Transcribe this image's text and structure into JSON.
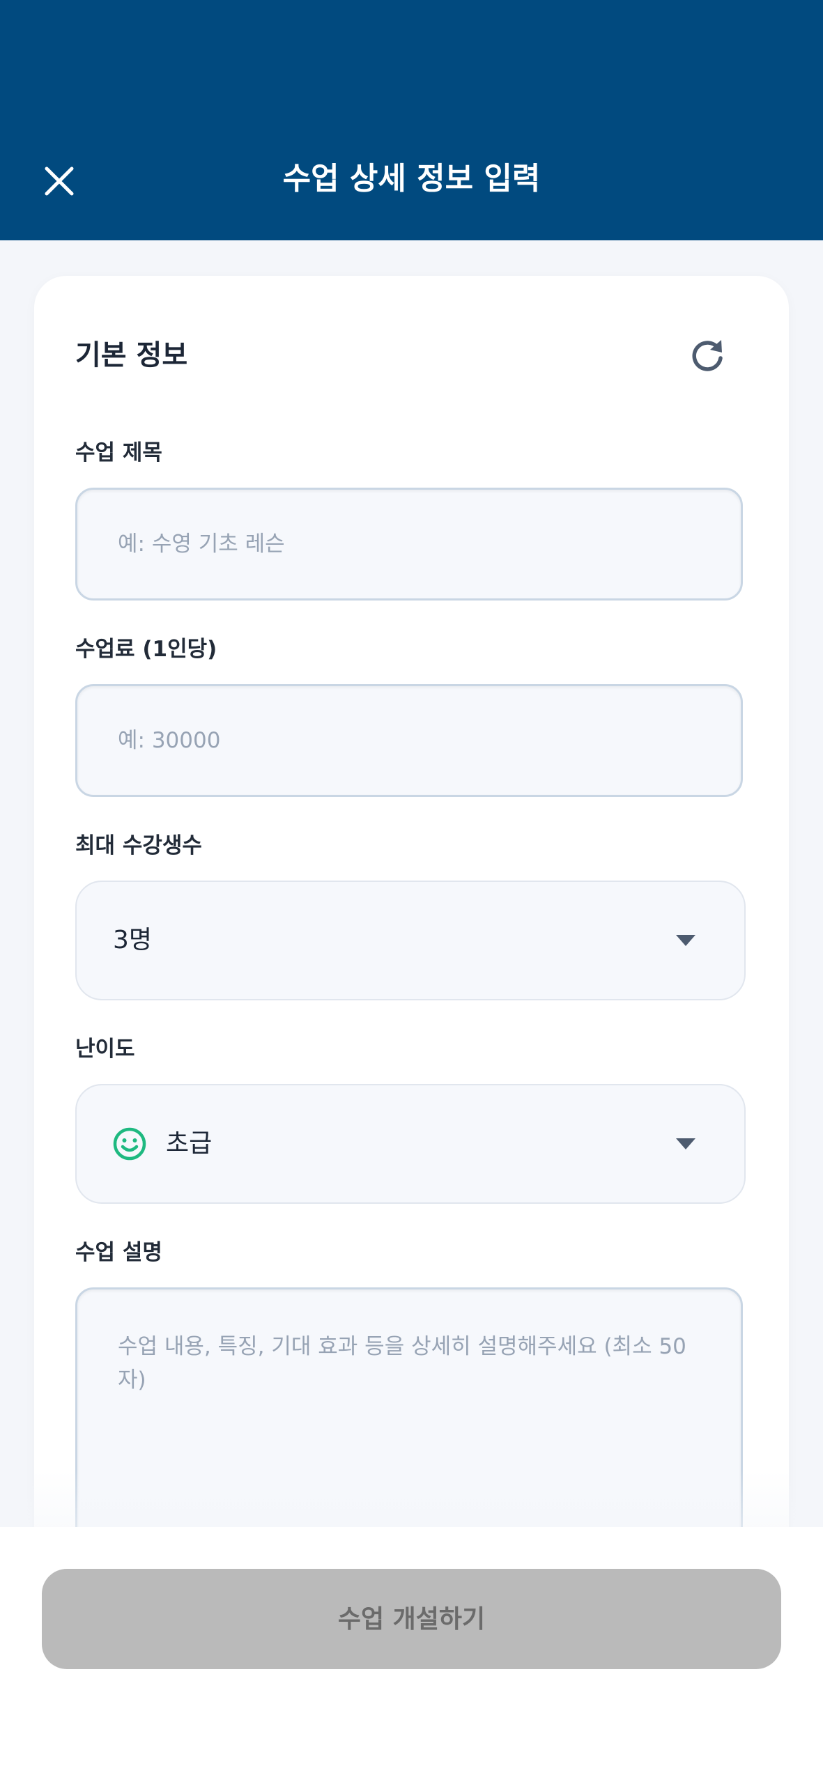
{
  "header": {
    "title": "수업 상세 정보 입력"
  },
  "section": {
    "title": "기본 정보"
  },
  "fields": {
    "title": {
      "label": "수업 제목",
      "placeholder": "예: 수영 기초 레슨"
    },
    "fee": {
      "label": "수업료 (1인당)",
      "placeholder": "예: 30000"
    },
    "max_students": {
      "label": "최대 수강생수",
      "value": "3명"
    },
    "difficulty": {
      "label": "난이도",
      "value": "초급",
      "icon": "smile-icon"
    },
    "description": {
      "label": "수업 설명",
      "placeholder": "수업 내용, 특징, 기대 효과 등을 상세히 설명해주세요 (최소 50자)"
    }
  },
  "footer": {
    "submit_label": "수업 개설하기"
  },
  "colors": {
    "header_bg": "#014a7f",
    "smile_icon": "#1eb980",
    "disabled_button": "#bababa"
  }
}
